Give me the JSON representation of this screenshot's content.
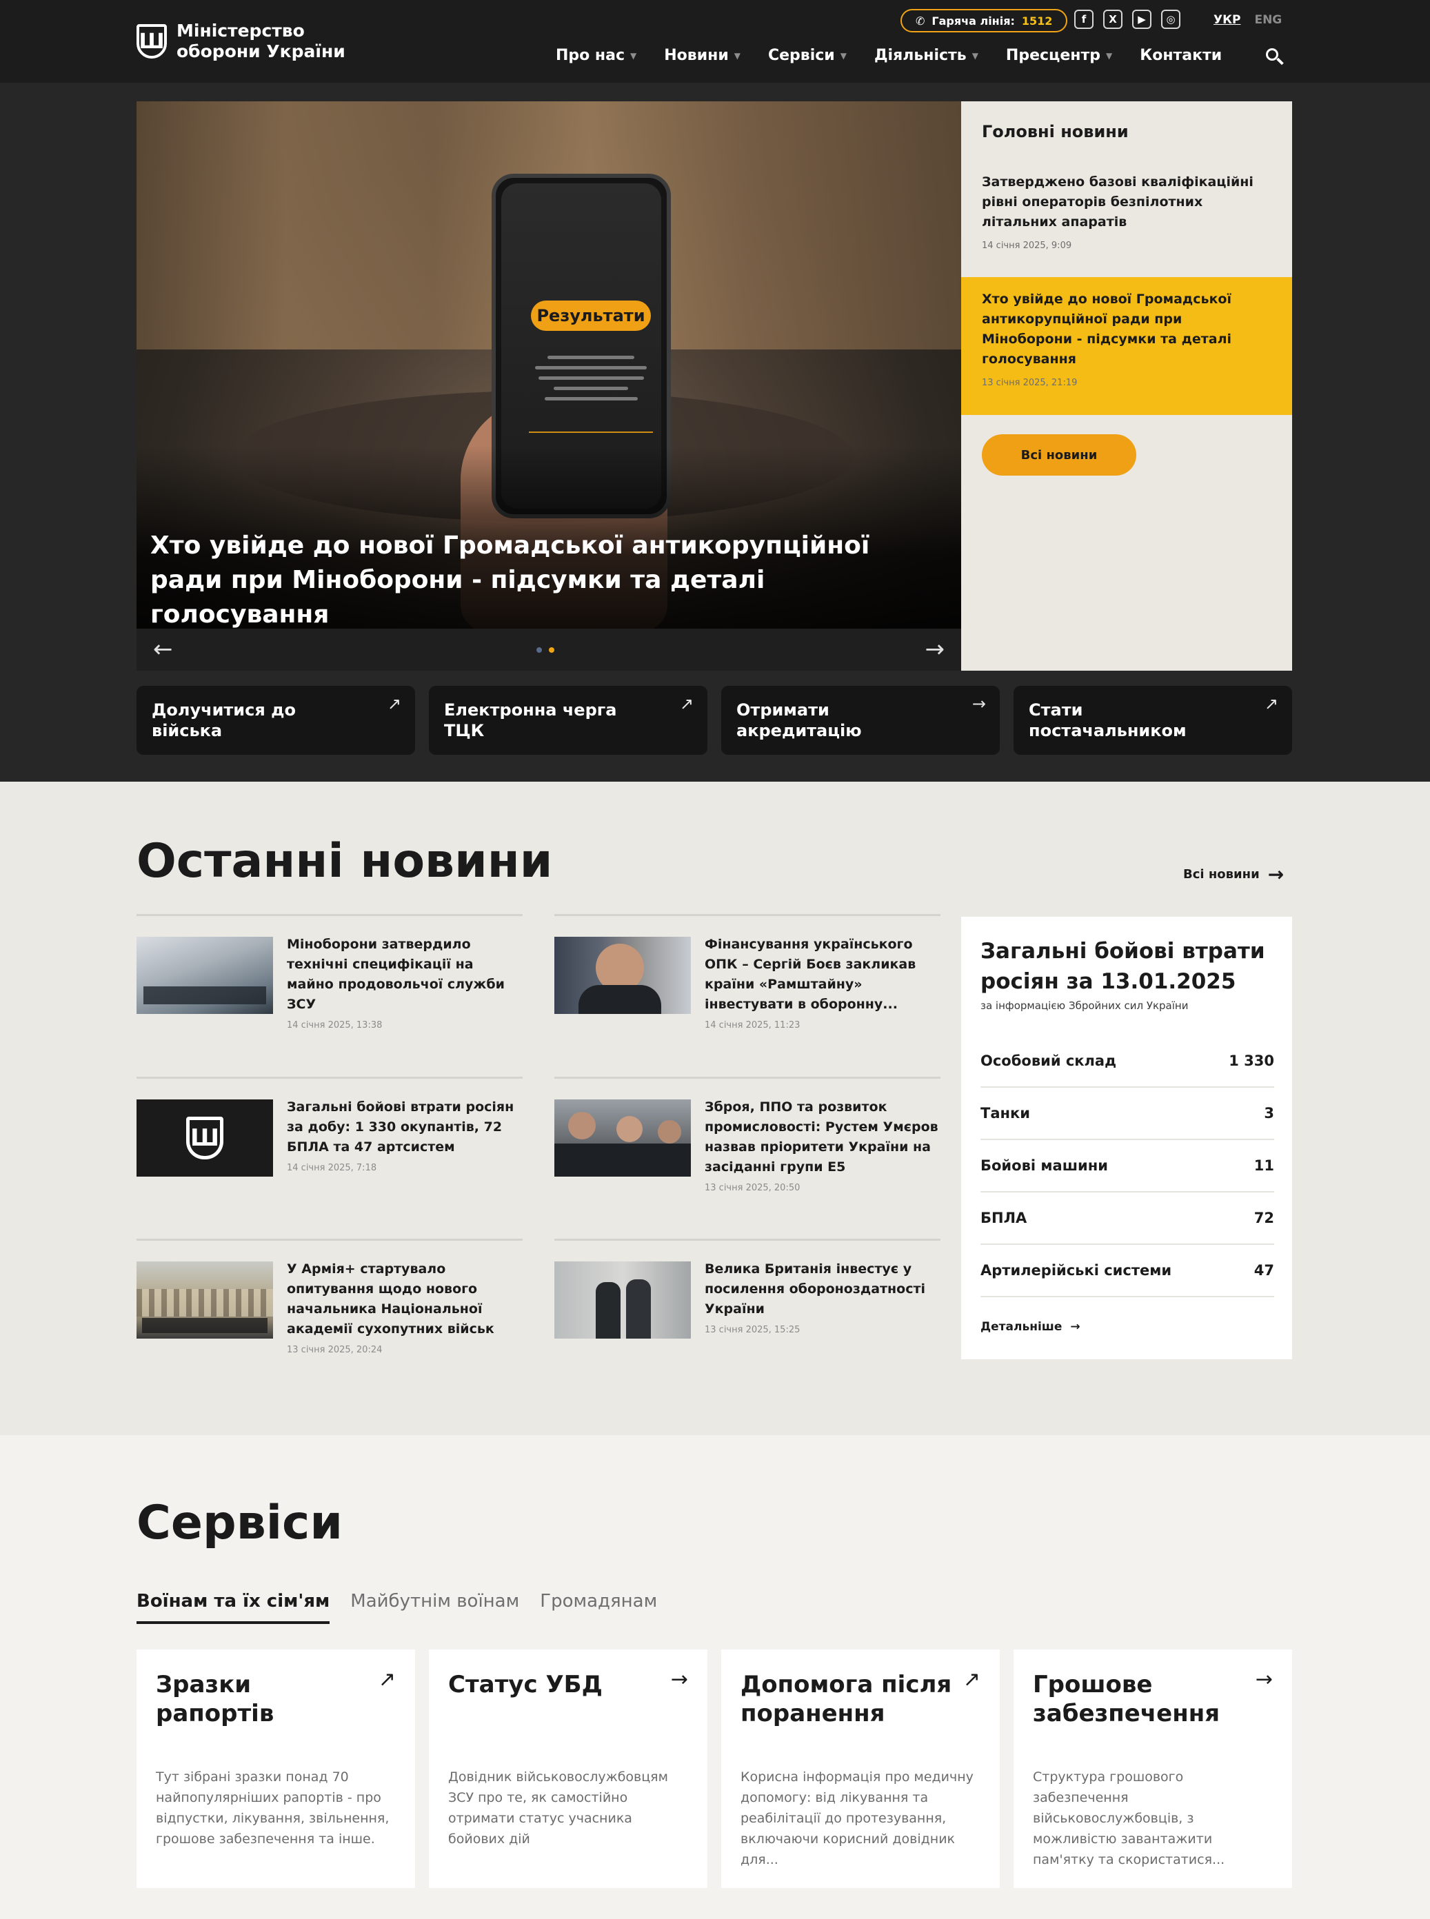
{
  "header": {
    "logo_text": "Міністерство оборони України",
    "logo_letter": "Ш",
    "hotline_label": "Гаряча лінія:",
    "hotline_number": "1512",
    "socials": [
      "f",
      "X",
      "▶",
      "◎"
    ],
    "lang_active": "УКР",
    "lang_other": "ENG",
    "nav": [
      {
        "label": "Про нас",
        "has_dropdown": true
      },
      {
        "label": "Новини",
        "has_dropdown": true
      },
      {
        "label": "Сервіси",
        "has_dropdown": true
      },
      {
        "label": "Діяльність",
        "has_dropdown": true
      },
      {
        "label": "Пресцентр",
        "has_dropdown": true
      },
      {
        "label": "Контакти",
        "has_dropdown": false
      }
    ],
    "search_icon": "search-icon"
  },
  "hero": {
    "title": "Хто увійде до нової Громадської антикорупційної ради при Міноборони - підсумки та деталі голосування",
    "phone_pill": "Результати",
    "arrow_prev": "←",
    "arrow_next": "→",
    "slides": 2,
    "active_slide": 2
  },
  "top_news": {
    "heading": "Головні новини",
    "items": [
      {
        "title": "Затверджено базові кваліфікаційні рівні операторів безпілотних літальних апаратів",
        "date": "14 січня 2025, 9:09",
        "highlighted": false
      },
      {
        "title": "Хто увійде до нової Громадської антикорупційної ради при Міноборони - підсумки та деталі голосування",
        "date": "13 січня 2025, 21:19",
        "highlighted": true
      }
    ],
    "all_button": "Всі новини"
  },
  "quick_links": [
    {
      "label": "Долучитися до війська",
      "icon": "↗"
    },
    {
      "label": "Електронна черга ТЦК",
      "icon": "↗"
    },
    {
      "label": "Отримати акредитацію",
      "icon": "→"
    },
    {
      "label": "Стати постачальником",
      "icon": "↗"
    }
  ],
  "latest": {
    "title": "Останні новини",
    "all_link": "Всі новини",
    "all_arrow": "→",
    "items": [
      {
        "title": "Міноборони затвердило технічні специфікації на майно продовольчої служби ЗСУ",
        "date": "14 січня 2025, 13:38"
      },
      {
        "title": "Фінансування українського ОПК – Сергій Боєв закликав країни «Рамштайну» інвестувати в оборонну...",
        "date": "14 січня 2025, 11:23"
      },
      {
        "title": "Загальні бойові втрати росіян за добу: 1 330 окупантів, 72 БПЛА та 47 артсистем",
        "date": "14 січня 2025, 7:18"
      },
      {
        "title": "Зброя, ППО та розвиток промисловості: Рустем Умєров назвав пріоритети України на засіданні групи Е5",
        "date": "13 січня 2025, 20:50"
      },
      {
        "title": "У Армія+ стартувало опитування щодо нового начальника Національної академії сухопутних військ",
        "date": "13 січня 2025, 20:24"
      },
      {
        "title": "Велика Британія інвестує у посилення обороноздатності України",
        "date": "13 січня 2025, 15:25"
      }
    ]
  },
  "losses": {
    "title": "Загальні бойові втрати росіян за 13.01.2025",
    "subtitle": "за інформацією Збройних сил України",
    "rows": [
      {
        "label": "Особовий склад",
        "value": "1 330"
      },
      {
        "label": "Танки",
        "value": "3"
      },
      {
        "label": "Бойові машини",
        "value": "11"
      },
      {
        "label": "БПЛА",
        "value": "72"
      },
      {
        "label": "Артилерійські системи",
        "value": "47"
      }
    ],
    "more": "Детальніше",
    "more_arrow": "→"
  },
  "services": {
    "title": "Сервіси",
    "tabs": [
      "Воїнам та їх сім'ям",
      "Майбутнім воїнам",
      "Громадянам"
    ],
    "active_tab": 0,
    "cards": [
      {
        "title": "Зразки рапортів",
        "icon": "↗",
        "desc": "Тут зібрані зразки понад 70 найпопулярніших рапортів - про відпустки, лікування, звільнення, грошове забезпечення та інше."
      },
      {
        "title": "Статус УБД",
        "icon": "→",
        "desc": "Довідник військовослужбовцям ЗСУ про те, як самостійно отримати статус учасника бойових дій"
      },
      {
        "title": "Допомога після поранення",
        "icon": "↗",
        "desc": "Корисна інформація про медичну допомогу: від лікування та реабілітації до протезування, включаючи корисний довідник для..."
      },
      {
        "title": "Грошове забезпечення",
        "icon": "→",
        "desc": "Структура грошового забезпечення військовослужбовців, з можливістю завантажити пам'ятку та скористатися..."
      }
    ]
  },
  "colors": {
    "header_bg": "#1c1c1c",
    "hero_band_bg": "#272727",
    "accent_orange": "#f0a014",
    "highlight_yellow": "#f6bc16",
    "page_bg": "#ebe9e4"
  }
}
